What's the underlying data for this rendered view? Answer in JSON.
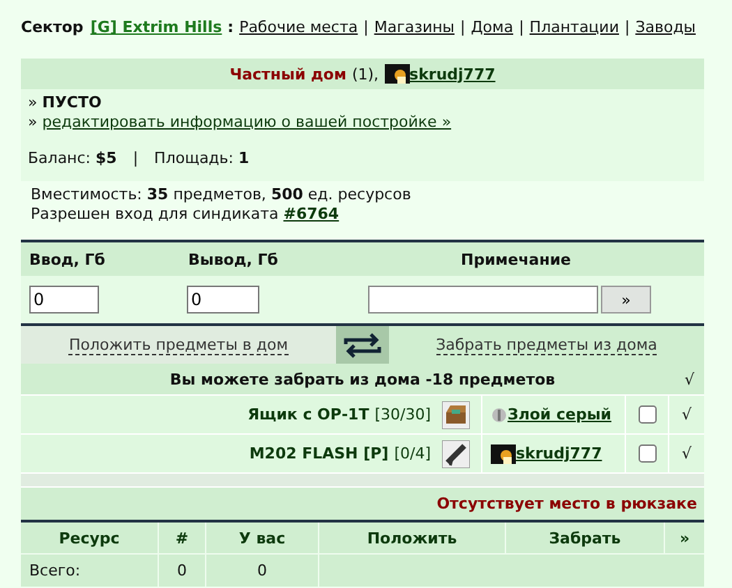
{
  "nav": {
    "label": "Сектор",
    "sector": "[G] Extrim Hills",
    "colon": ":",
    "separator": "|",
    "links": [
      "Рабочие места",
      "Магазины",
      "Дома",
      "Плантации",
      "Заводы"
    ]
  },
  "house": {
    "title": "Частный дом",
    "count": "(1),",
    "owner": "skrudj777",
    "bullet": "»",
    "status": "ПУСТО",
    "edit_link": "редактировать информацию о вашей постройке »",
    "balance_label": "Баланс:",
    "balance": "$5",
    "separator": "|",
    "area_label": "Площадь:",
    "area": "1"
  },
  "capacity": "Вместимость: **35** предметов, **500** ед. ресурсов",
  "access": {
    "text": "Разрешен вход для синдиката",
    "link": "#6764"
  },
  "traffic": {
    "columns": [
      "Ввод, Гб",
      "Вывод, Гб",
      "Примечание"
    ],
    "input": "0",
    "output": "0",
    "submit": "»"
  },
  "tabs": [
    {
      "label": "Положить предметы в дом",
      "selected": false
    },
    {
      "label": "Забрать предметы из дома",
      "selected": true
    }
  ],
  "notice": {
    "text": "Вы можете забрать из дома -18 предметов",
    "mark": "√"
  },
  "items": [
    {
      "name": "Ящик с ОР-1Т",
      "count": "[30/30]",
      "kind": "crate",
      "owner": {
        "name": "Злой серый",
        "kind": "dot"
      },
      "checked": false,
      "mark": "√"
    },
    {
      "name": "M202 FLASH [P]",
      "count": "[0/4]",
      "kind": "launcher",
      "owner": {
        "name": "skrudj777",
        "kind": "avatar"
      },
      "checked": false,
      "mark": "√"
    }
  ],
  "warning": "Отсутствует место в рюкзаке",
  "resources": {
    "columns": [
      "Ресурс",
      "#",
      "У вас",
      "Положить",
      "Забрать",
      "»"
    ],
    "total": [
      "Всего:",
      "0",
      "0"
    ]
  }
}
